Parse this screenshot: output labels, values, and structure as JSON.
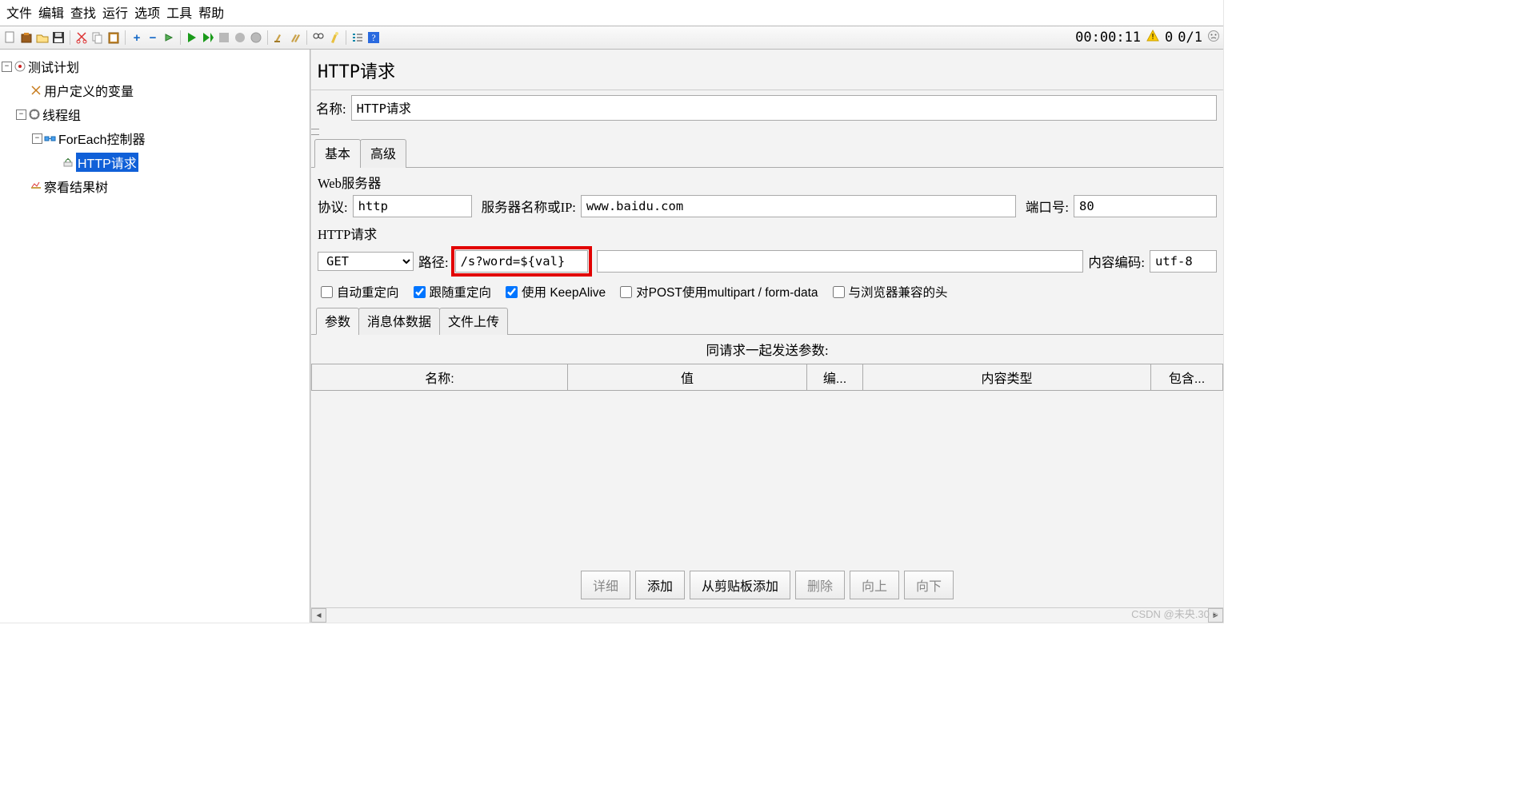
{
  "menu": [
    "文件",
    "编辑",
    "查找",
    "运行",
    "选项",
    "工具",
    "帮助"
  ],
  "status": {
    "time": "00:00:11",
    "warn": "0",
    "counter": "0/1"
  },
  "tree": {
    "root": "测试计划",
    "vars": "用户定义的变量",
    "threadgroup": "线程组",
    "foreach": "ForEach控制器",
    "httpreq": "HTTP请求",
    "results": "察看结果树"
  },
  "panel": {
    "title": "HTTP请求",
    "name_label": "名称:",
    "name_value": "HTTP请求"
  },
  "tabs": {
    "basic": "基本",
    "advanced": "高级"
  },
  "webserver": {
    "section": "Web服务器",
    "protocol_label": "协议:",
    "protocol": "http",
    "server_label": "服务器名称或IP:",
    "server": "www.baidu.com",
    "port_label": "端口号:",
    "port": "80"
  },
  "httpreq": {
    "section": "HTTP请求",
    "method": "GET",
    "path_label": "路径:",
    "path": "/s?word=${val}",
    "encoding_label": "内容编码:",
    "encoding": "utf-8"
  },
  "checkboxes": {
    "auto_redirect": "自动重定向",
    "follow_redirect": "跟随重定向",
    "keepalive": "使用 KeepAlive",
    "multipart": "对POST使用multipart / form-data",
    "browser_compat": "与浏览器兼容的头"
  },
  "inner_tabs": {
    "params": "参数",
    "body": "消息体数据",
    "file": "文件上传"
  },
  "params_table": {
    "section_label": "同请求一起发送参数:",
    "columns": {
      "name": "名称:",
      "value": "值",
      "encode": "编...",
      "content_type": "内容类型",
      "include": "包含..."
    }
  },
  "buttons": {
    "detail": "详细",
    "add": "添加",
    "from_clipboard": "从剪贴板添加",
    "delete": "删除",
    "up": "向上",
    "down": "向下"
  },
  "watermark": "CSDN @未央.30 >"
}
